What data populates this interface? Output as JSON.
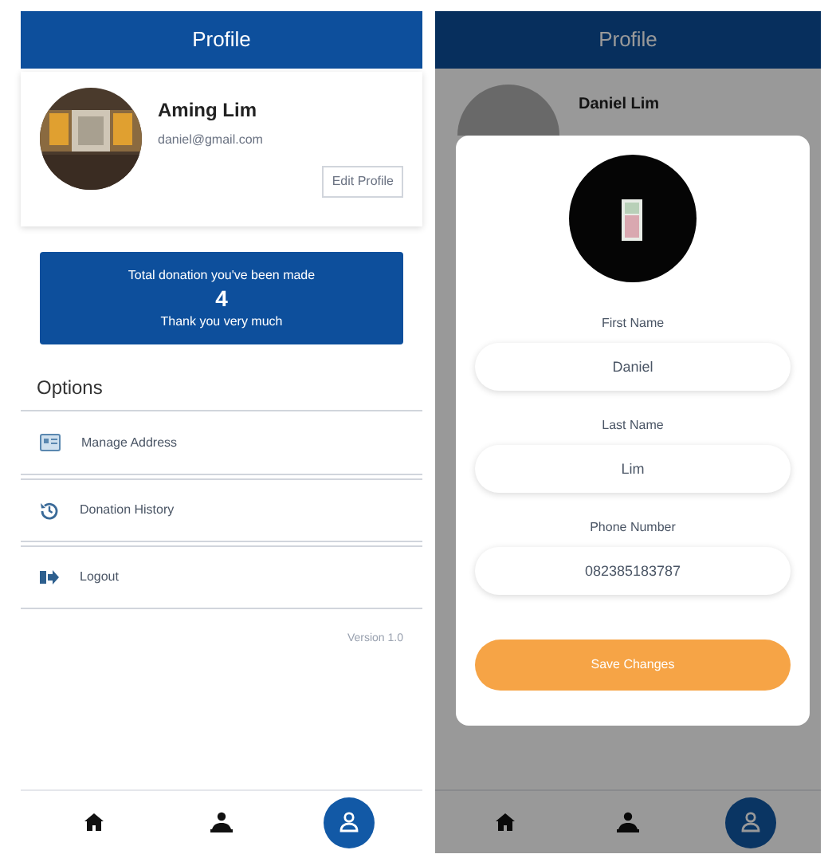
{
  "profile_screen": {
    "header": {
      "title": "Profile"
    },
    "profile": {
      "name": "Aming Lim",
      "email": "daniel@gmail.com",
      "edit_button": "Edit Profile"
    },
    "donation": {
      "caption": "Total donation you've been made",
      "count": "4",
      "thanks": "Thank you very much"
    },
    "options": {
      "title": "Options",
      "items": [
        {
          "kind": "address",
          "label": "Manage Address"
        },
        {
          "kind": "history",
          "label": "Donation History"
        },
        {
          "kind": "logout",
          "label": "Logout"
        }
      ]
    },
    "version": "Version 1.0",
    "nav": [
      {
        "kind": "home",
        "selected": false
      },
      {
        "kind": "donate",
        "selected": false
      },
      {
        "kind": "profile",
        "selected": true
      }
    ]
  },
  "edit_screen": {
    "header": {
      "title": "Profile"
    },
    "background_name": "Daniel Lim",
    "modal": {
      "fields": [
        {
          "label": "First Name",
          "value": "Daniel"
        },
        {
          "label": "Last Name",
          "value": "Lim"
        },
        {
          "label": "Phone Number",
          "value": "082385183787"
        }
      ],
      "save_button": "Save Changes"
    },
    "nav": [
      {
        "kind": "home",
        "selected": false
      },
      {
        "kind": "donate",
        "selected": false
      },
      {
        "kind": "profile",
        "selected": true
      }
    ]
  }
}
